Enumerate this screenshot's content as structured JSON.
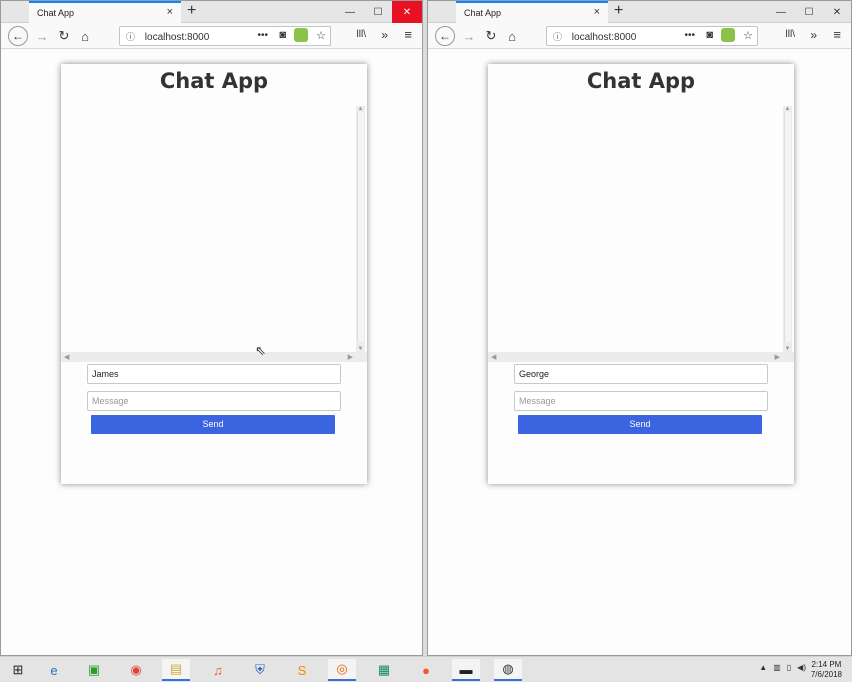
{
  "windows": [
    {
      "tab_title": "Chat App",
      "url": "localhost:8000",
      "app_title": "Chat App",
      "name_value": "James",
      "message_placeholder": "Message",
      "send_label": "Send"
    },
    {
      "tab_title": "Chat App",
      "url": "localhost:8000",
      "app_title": "Chat App",
      "name_value": "George",
      "message_placeholder": "Message",
      "send_label": "Send"
    }
  ],
  "icons": {
    "close_tab": "×",
    "new_tab": "+",
    "back": "←",
    "forward": "→",
    "reload": "↻",
    "home": "⌂",
    "page_actions": "•••",
    "library": "lll\\",
    "overflow": "»",
    "menu": "≡",
    "minimize": "—",
    "maximize": "☐",
    "close_window": "✕"
  },
  "taskbar": {
    "apps": [
      "windows-start",
      "edge",
      "store",
      "chrome",
      "file-explorer",
      "headphones",
      "defender",
      "sublime",
      "firefox",
      "editor",
      "postman",
      "terminal",
      "obs"
    ],
    "time": "2:14 PM",
    "date": "7/6/2018"
  },
  "colors": {
    "accent": "#3b64e0",
    "active_tab_border": "#0a84ff",
    "close_red": "#e81123"
  }
}
